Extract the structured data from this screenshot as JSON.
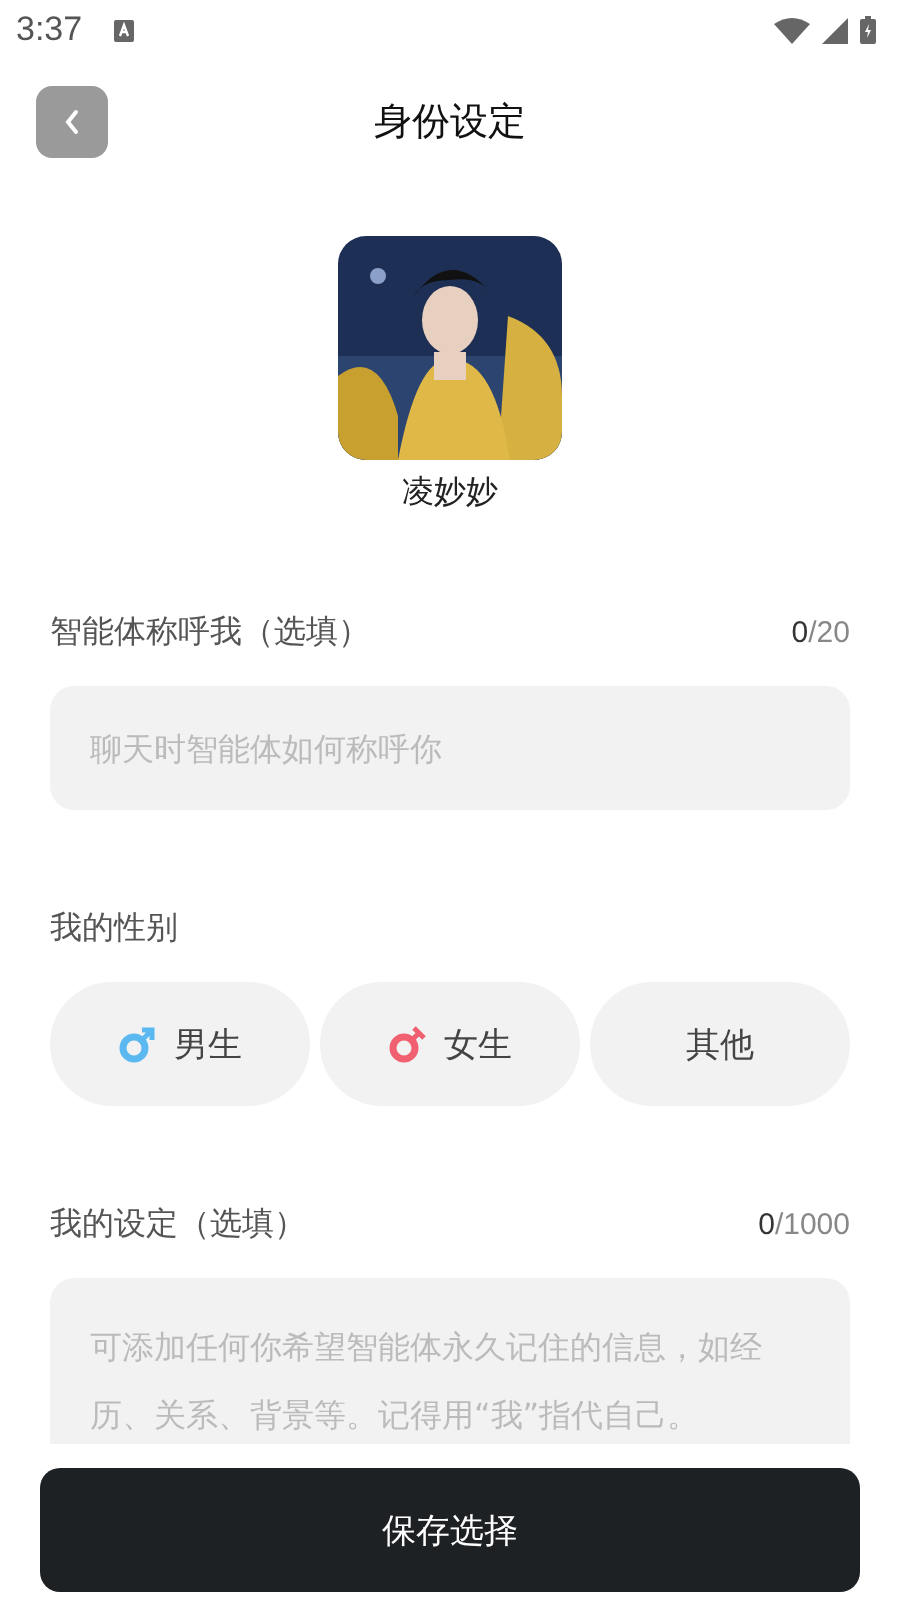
{
  "status_bar": {
    "time": "3:37"
  },
  "header": {
    "title": "身份设定"
  },
  "profile": {
    "name": "凌妙妙"
  },
  "nickname": {
    "label": "智能体称呼我（选填）",
    "count": "0",
    "limit": "/20",
    "placeholder": "聊天时智能体如何称呼你"
  },
  "gender": {
    "label": "我的性别",
    "options": [
      {
        "label": "男生",
        "kind": "male",
        "selected": false
      },
      {
        "label": "女生",
        "kind": "female",
        "selected": false
      },
      {
        "label": "其他",
        "kind": "other",
        "selected": false
      }
    ]
  },
  "persona": {
    "label": "我的设定（选填）",
    "count": "0",
    "limit": "/1000",
    "placeholder": "可添加任何你希望智能体永久记住的信息，如经历、关系、背景等。记得用“我”指代自己。"
  },
  "save_button": "保存选择"
}
